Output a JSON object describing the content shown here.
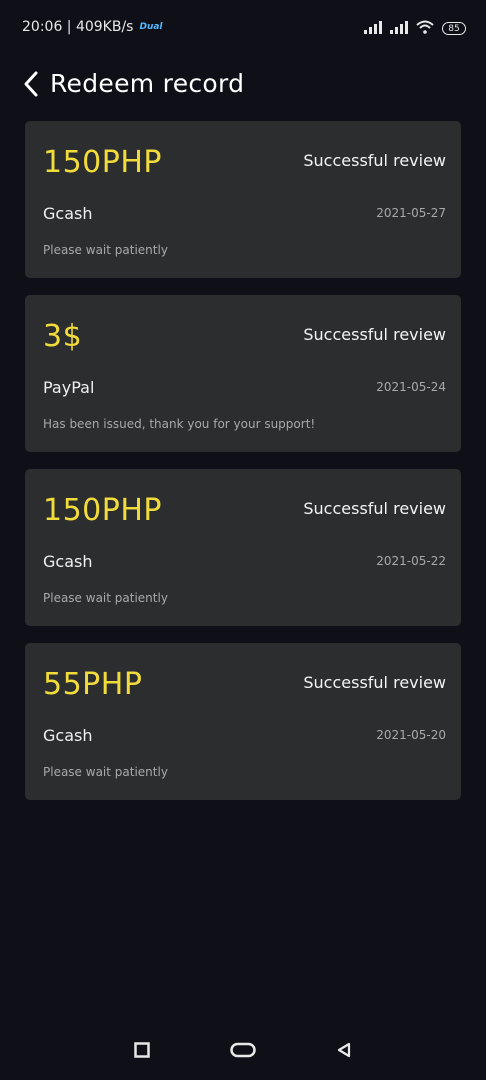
{
  "status_bar": {
    "time_speed": "20:06 | 409KB/s",
    "app_badge": "Dual",
    "battery": "85"
  },
  "header": {
    "title": "Redeem record"
  },
  "records": [
    {
      "amount": "150PHP",
      "status": "Successful review",
      "method": "Gcash",
      "date": "2021-05-27",
      "note": "Please wait patiently"
    },
    {
      "amount": "3$",
      "status": "Successful review",
      "method": "PayPal",
      "date": "2021-05-24",
      "note": "Has been issued, thank you for your support!"
    },
    {
      "amount": "150PHP",
      "status": "Successful review",
      "method": "Gcash",
      "date": "2021-05-22",
      "note": "Please wait patiently"
    },
    {
      "amount": "55PHP",
      "status": "Successful review",
      "method": "Gcash",
      "date": "2021-05-20",
      "note": "Please wait patiently"
    }
  ],
  "colors": {
    "background": "#0f1017",
    "card": "#2c2d2f",
    "amount": "#f2dc3b",
    "secondary_text": "#a8a9ad"
  },
  "icons": {
    "back": "chevron-left-icon",
    "nav_recents": "square-icon",
    "nav_home": "rounded-rect-icon",
    "nav_back": "triangle-left-icon",
    "signal": "cellular-signal-icon",
    "wifi": "wifi-icon",
    "battery": "battery-icon"
  }
}
